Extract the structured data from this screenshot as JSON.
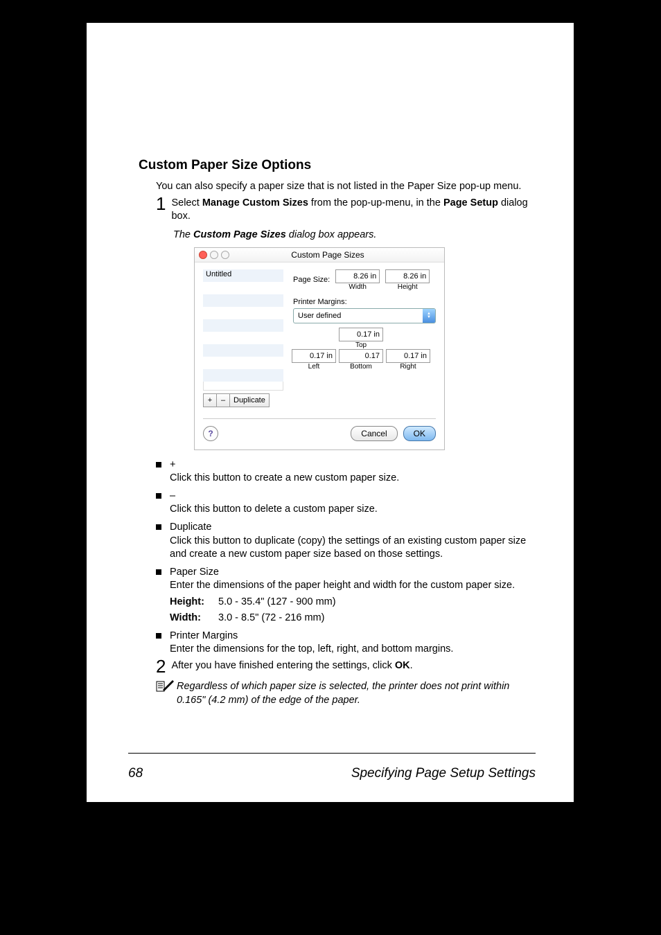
{
  "heading": "Custom Paper Size Options",
  "intro": "You can also specify a paper size that is not listed in the Paper Size pop-up menu.",
  "step1": {
    "num": "1",
    "pre": "Select ",
    "bold1": "Manage Custom Sizes",
    "mid": " from the pop-up-menu, in the ",
    "bold2": "Page Setup",
    "post": " dialog box."
  },
  "caption": {
    "pre": "The ",
    "bold": "Custom Page Sizes",
    "post": " dialog box appears."
  },
  "dialog": {
    "title": "Custom Page Sizes",
    "list_item": "Untitled",
    "btn_plus": "+",
    "btn_minus": "–",
    "btn_dup": "Duplicate",
    "page_size_label": "Page Size:",
    "width_val": "8.26 in",
    "width_cap": "Width",
    "height_val": "8.26 in",
    "height_cap": "Height",
    "margins_label": "Printer Margins:",
    "combo_val": "User defined",
    "top_val": "0.17 in",
    "top_cap": "Top",
    "left_val": "0.17 in",
    "left_cap": "Left",
    "right_val": "0.17 in",
    "right_cap": "Right",
    "bottom_val": "0.17",
    "bottom_cap": "Bottom",
    "help": "?",
    "cancel": "Cancel",
    "ok": "OK"
  },
  "bullets": {
    "plus": {
      "head": "+",
      "body": "Click this button to create a new custom paper size."
    },
    "minus": {
      "head": "–",
      "body": "Click this button to delete a custom paper size."
    },
    "dup": {
      "head": "Duplicate",
      "body": "Click this button to duplicate (copy) the settings of an existing custom paper size and create a new custom paper size based on those settings."
    },
    "psize": {
      "head": "Paper Size",
      "body": "Enter the dimensions of the paper height and width for the custom paper size.",
      "height_label": "Height",
      "height_colon": ":",
      "height_val": "5.0 - 35.4\" (127 - 900 mm)",
      "width_label": "Width",
      "width_colon": ":",
      "width_val": "3.0 - 8.5\" (72 - 216 mm)"
    },
    "pmarg": {
      "head": "Printer Margins",
      "body": "Enter the dimensions for the top, left, right, and bottom margins."
    }
  },
  "step2": {
    "num": "2",
    "pre": "After you have finished entering the settings, click ",
    "bold": "OK",
    "post": "."
  },
  "note": "Regardless of which paper size is selected, the printer does not print within 0.165\" (4.2 mm) of the edge of the paper.",
  "footer": {
    "page": "68",
    "section": "Specifying Page Setup Settings"
  }
}
